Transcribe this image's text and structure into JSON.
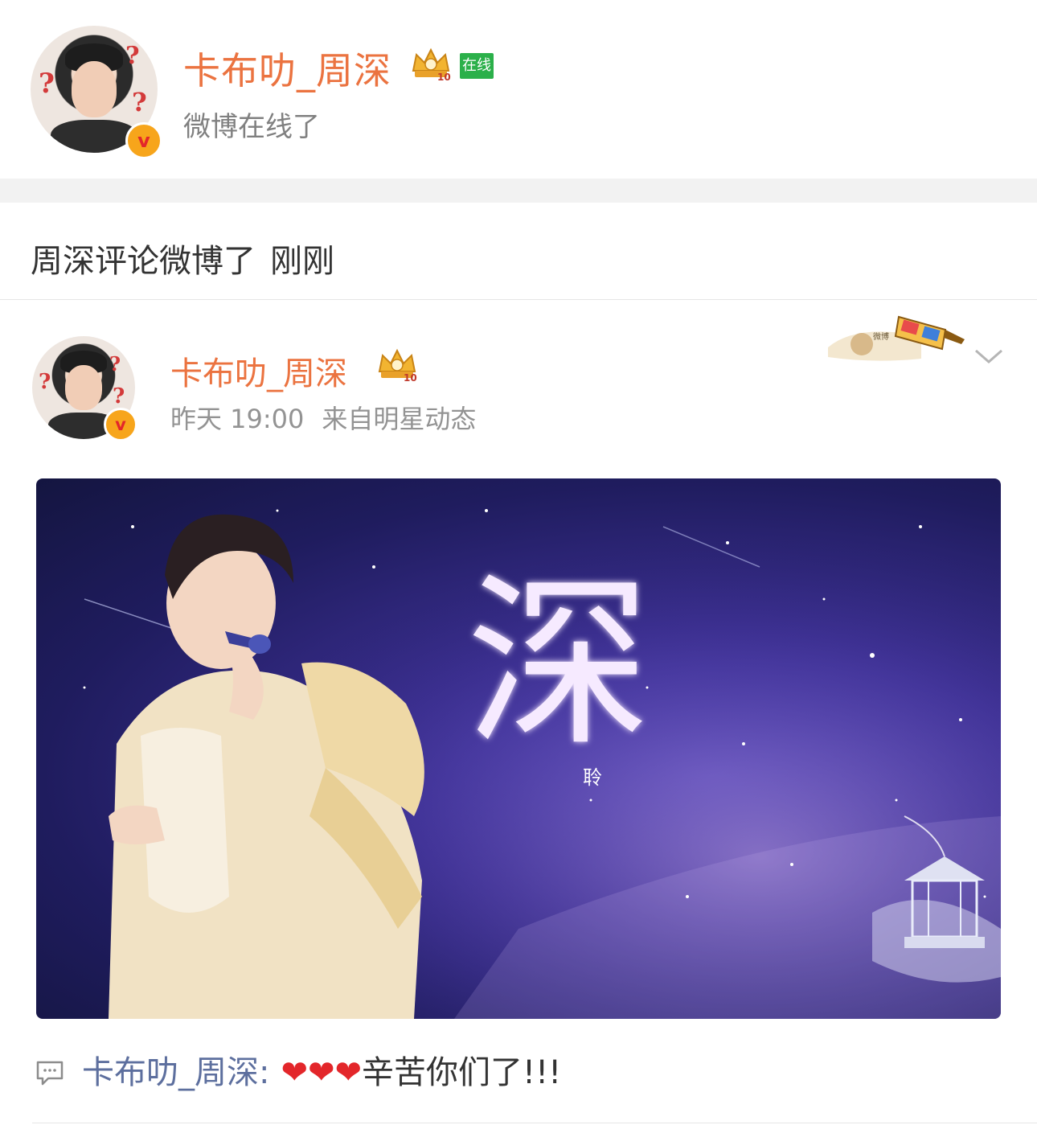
{
  "profile": {
    "name": "卡布叻_周深",
    "online_badge": "在线",
    "status_text": "微博在线了"
  },
  "activity": {
    "text": "周深评论微博了",
    "time": "刚刚"
  },
  "post": {
    "author": "卡布叻_周深",
    "time": "昨天 19:00",
    "source": "来自明星动态",
    "image_title": "深",
    "image_subtitle": "聆"
  },
  "comment": {
    "user": "卡布叻_周深:",
    "hearts": "❤❤❤",
    "text": "辛苦你们了!!!"
  },
  "colors": {
    "accent_name": "#eb7340",
    "link_blue": "#5d6f9e",
    "online_green": "#2bb04a",
    "verified_orange": "#f7a51b"
  },
  "icons": [
    "verified-v-icon",
    "crown-level-icon",
    "chevron-down-icon",
    "comment-icon",
    "3d-glasses-decoration"
  ]
}
